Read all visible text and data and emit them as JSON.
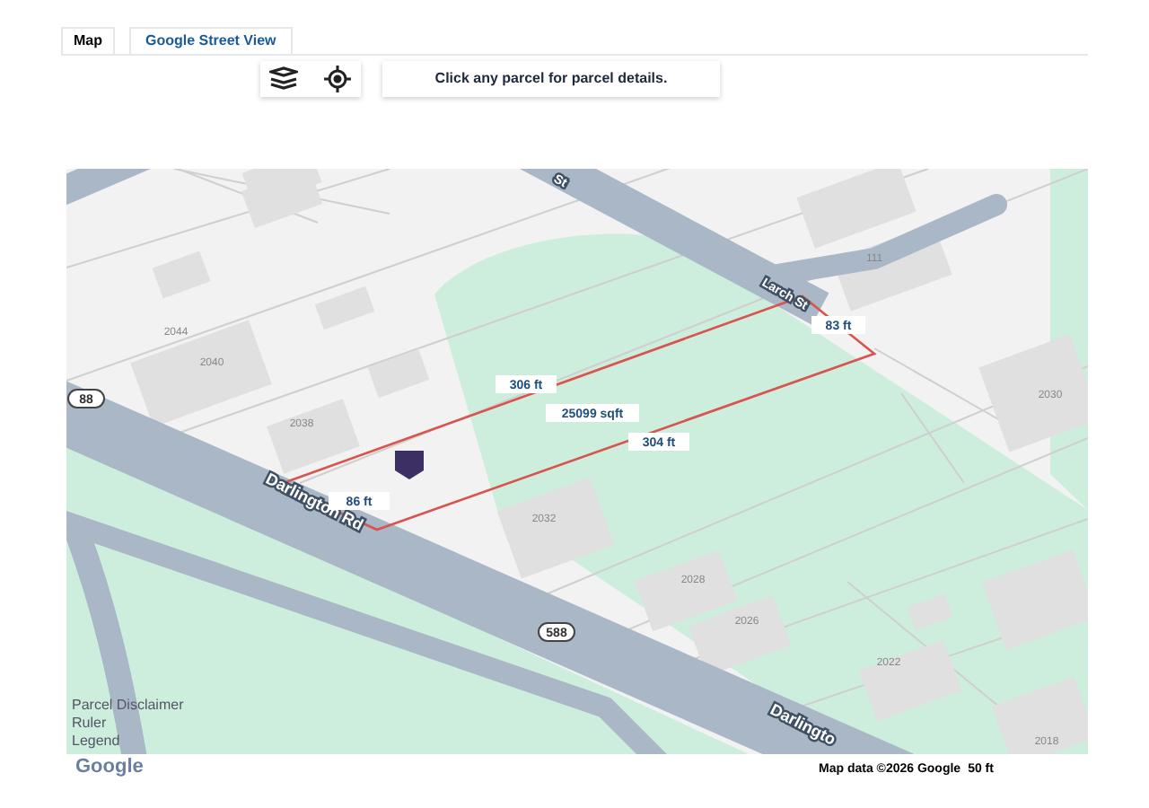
{
  "tabs": [
    {
      "label": "Map",
      "selected": true
    },
    {
      "label": "Google Street View",
      "selected": false
    }
  ],
  "message": "Click any parcel for parcel details.",
  "map": {
    "street_labels": [
      "Darlington Rd",
      "Larch St",
      "Darlingto",
      "St"
    ],
    "route_shields": [
      "588",
      "88"
    ],
    "house_numbers": [
      "2044",
      "2040",
      "2038",
      "2032",
      "2028",
      "2026",
      "2022",
      "2018",
      "2030",
      "111"
    ],
    "measurements": [
      "306 ft",
      "25099 sqft",
      "304 ft",
      "86 ft",
      "83 ft"
    ],
    "links": [
      "Parcel Disclaimer",
      "Ruler",
      "Legend"
    ]
  },
  "footer": {
    "logo": "Google",
    "attribution": "Map data ©2026 Google",
    "scale": "50 ft"
  }
}
